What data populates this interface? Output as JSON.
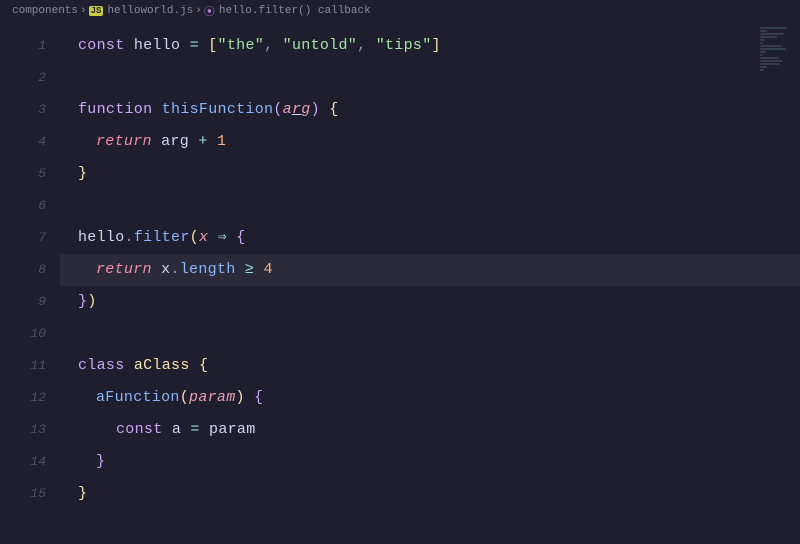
{
  "breadcrumbs": {
    "folder": "components",
    "file": "helloworld.js",
    "symbol": "hello.filter() callback"
  },
  "colors": {
    "keyword": "#cba6f7",
    "keywordItalic": "#f38ba8",
    "variable": "#cdd6f4",
    "string": "#a6e3a1",
    "funcName": "#89b4fa",
    "param": "#eba0ac",
    "punct": "#9399b2",
    "brace": "#f9e2af",
    "braceAlt": "#cba6f7",
    "operator": "#94e2d5",
    "number": "#fab387",
    "classKw": "#cba6f7",
    "className": "#f9e2af",
    "method": "#89b4fa",
    "prop": "#89b4fa"
  },
  "lines": [
    {
      "n": "1",
      "highlight": false,
      "indent": 0,
      "tokens": [
        {
          "t": "const ",
          "c": "keyword"
        },
        {
          "t": "hello ",
          "c": "variable"
        },
        {
          "t": "= ",
          "c": "operator"
        },
        {
          "t": "[",
          "c": "brace"
        },
        {
          "t": "\"the\"",
          "c": "string"
        },
        {
          "t": ", ",
          "c": "punct"
        },
        {
          "t": "\"untold\"",
          "c": "string"
        },
        {
          "t": ", ",
          "c": "punct"
        },
        {
          "t": "\"tips\"",
          "c": "string"
        },
        {
          "t": "]",
          "c": "brace"
        }
      ]
    },
    {
      "n": "2",
      "highlight": false,
      "indent": 0,
      "tokens": []
    },
    {
      "n": "3",
      "highlight": false,
      "indent": 0,
      "tokens": [
        {
          "t": "function ",
          "c": "keyword"
        },
        {
          "t": "thisFunction",
          "c": "funcName"
        },
        {
          "t": "(",
          "c": "braceAlt"
        },
        {
          "t": "a",
          "c": "param",
          "ital": true
        },
        {
          "t": "r",
          "c": "param",
          "ital": true,
          "cursor": true
        },
        {
          "t": "g",
          "c": "param",
          "ital": true
        },
        {
          "t": ") ",
          "c": "braceAlt"
        },
        {
          "t": "{",
          "c": "brace"
        }
      ]
    },
    {
      "n": "4",
      "highlight": false,
      "indent": 1,
      "tokens": [
        {
          "t": "return ",
          "c": "keywordItalic",
          "ital": true
        },
        {
          "t": "arg ",
          "c": "variable"
        },
        {
          "t": "+ ",
          "c": "operator"
        },
        {
          "t": "1",
          "c": "number"
        }
      ]
    },
    {
      "n": "5",
      "highlight": false,
      "indent": 0,
      "tokens": [
        {
          "t": "}",
          "c": "brace"
        }
      ]
    },
    {
      "n": "6",
      "highlight": false,
      "indent": 0,
      "tokens": []
    },
    {
      "n": "7",
      "highlight": false,
      "indent": 0,
      "tokens": [
        {
          "t": "hello",
          "c": "variable"
        },
        {
          "t": ".",
          "c": "punct"
        },
        {
          "t": "filter",
          "c": "method"
        },
        {
          "t": "(",
          "c": "brace"
        },
        {
          "t": "x ",
          "c": "param",
          "ital": true
        },
        {
          "t": "⇒ ",
          "c": "operator"
        },
        {
          "t": "{",
          "c": "braceAlt"
        }
      ]
    },
    {
      "n": "8",
      "highlight": true,
      "indent": 1,
      "tokens": [
        {
          "t": "return ",
          "c": "keywordItalic",
          "ital": true
        },
        {
          "t": "x",
          "c": "variable"
        },
        {
          "t": ".",
          "c": "punct"
        },
        {
          "t": "length ",
          "c": "prop"
        },
        {
          "t": "≥ ",
          "c": "operator"
        },
        {
          "t": "4",
          "c": "number"
        }
      ]
    },
    {
      "n": "9",
      "highlight": false,
      "indent": 0,
      "tokens": [
        {
          "t": "}",
          "c": "braceAlt"
        },
        {
          "t": ")",
          "c": "brace"
        }
      ]
    },
    {
      "n": "10",
      "highlight": false,
      "indent": 0,
      "tokens": []
    },
    {
      "n": "11",
      "highlight": false,
      "indent": 0,
      "tokens": [
        {
          "t": "class ",
          "c": "classKw"
        },
        {
          "t": "aClass ",
          "c": "className"
        },
        {
          "t": "{",
          "c": "brace"
        }
      ]
    },
    {
      "n": "12",
      "highlight": false,
      "indent": 1,
      "tokens": [
        {
          "t": "aFunction",
          "c": "funcName"
        },
        {
          "t": "(",
          "c": "brace"
        },
        {
          "t": "param",
          "c": "param",
          "ital": true
        },
        {
          "t": ") ",
          "c": "brace"
        },
        {
          "t": "{",
          "c": "braceAlt"
        }
      ]
    },
    {
      "n": "13",
      "highlight": false,
      "indent": 2,
      "tokens": [
        {
          "t": "const ",
          "c": "keyword"
        },
        {
          "t": "a ",
          "c": "variable"
        },
        {
          "t": "= ",
          "c": "operator"
        },
        {
          "t": "param",
          "c": "variable"
        }
      ]
    },
    {
      "n": "14",
      "highlight": false,
      "indent": 1,
      "tokens": [
        {
          "t": "}",
          "c": "braceAlt"
        }
      ]
    },
    {
      "n": "15",
      "highlight": false,
      "indent": 0,
      "tokens": [
        {
          "t": "}",
          "c": "brace"
        }
      ]
    }
  ]
}
